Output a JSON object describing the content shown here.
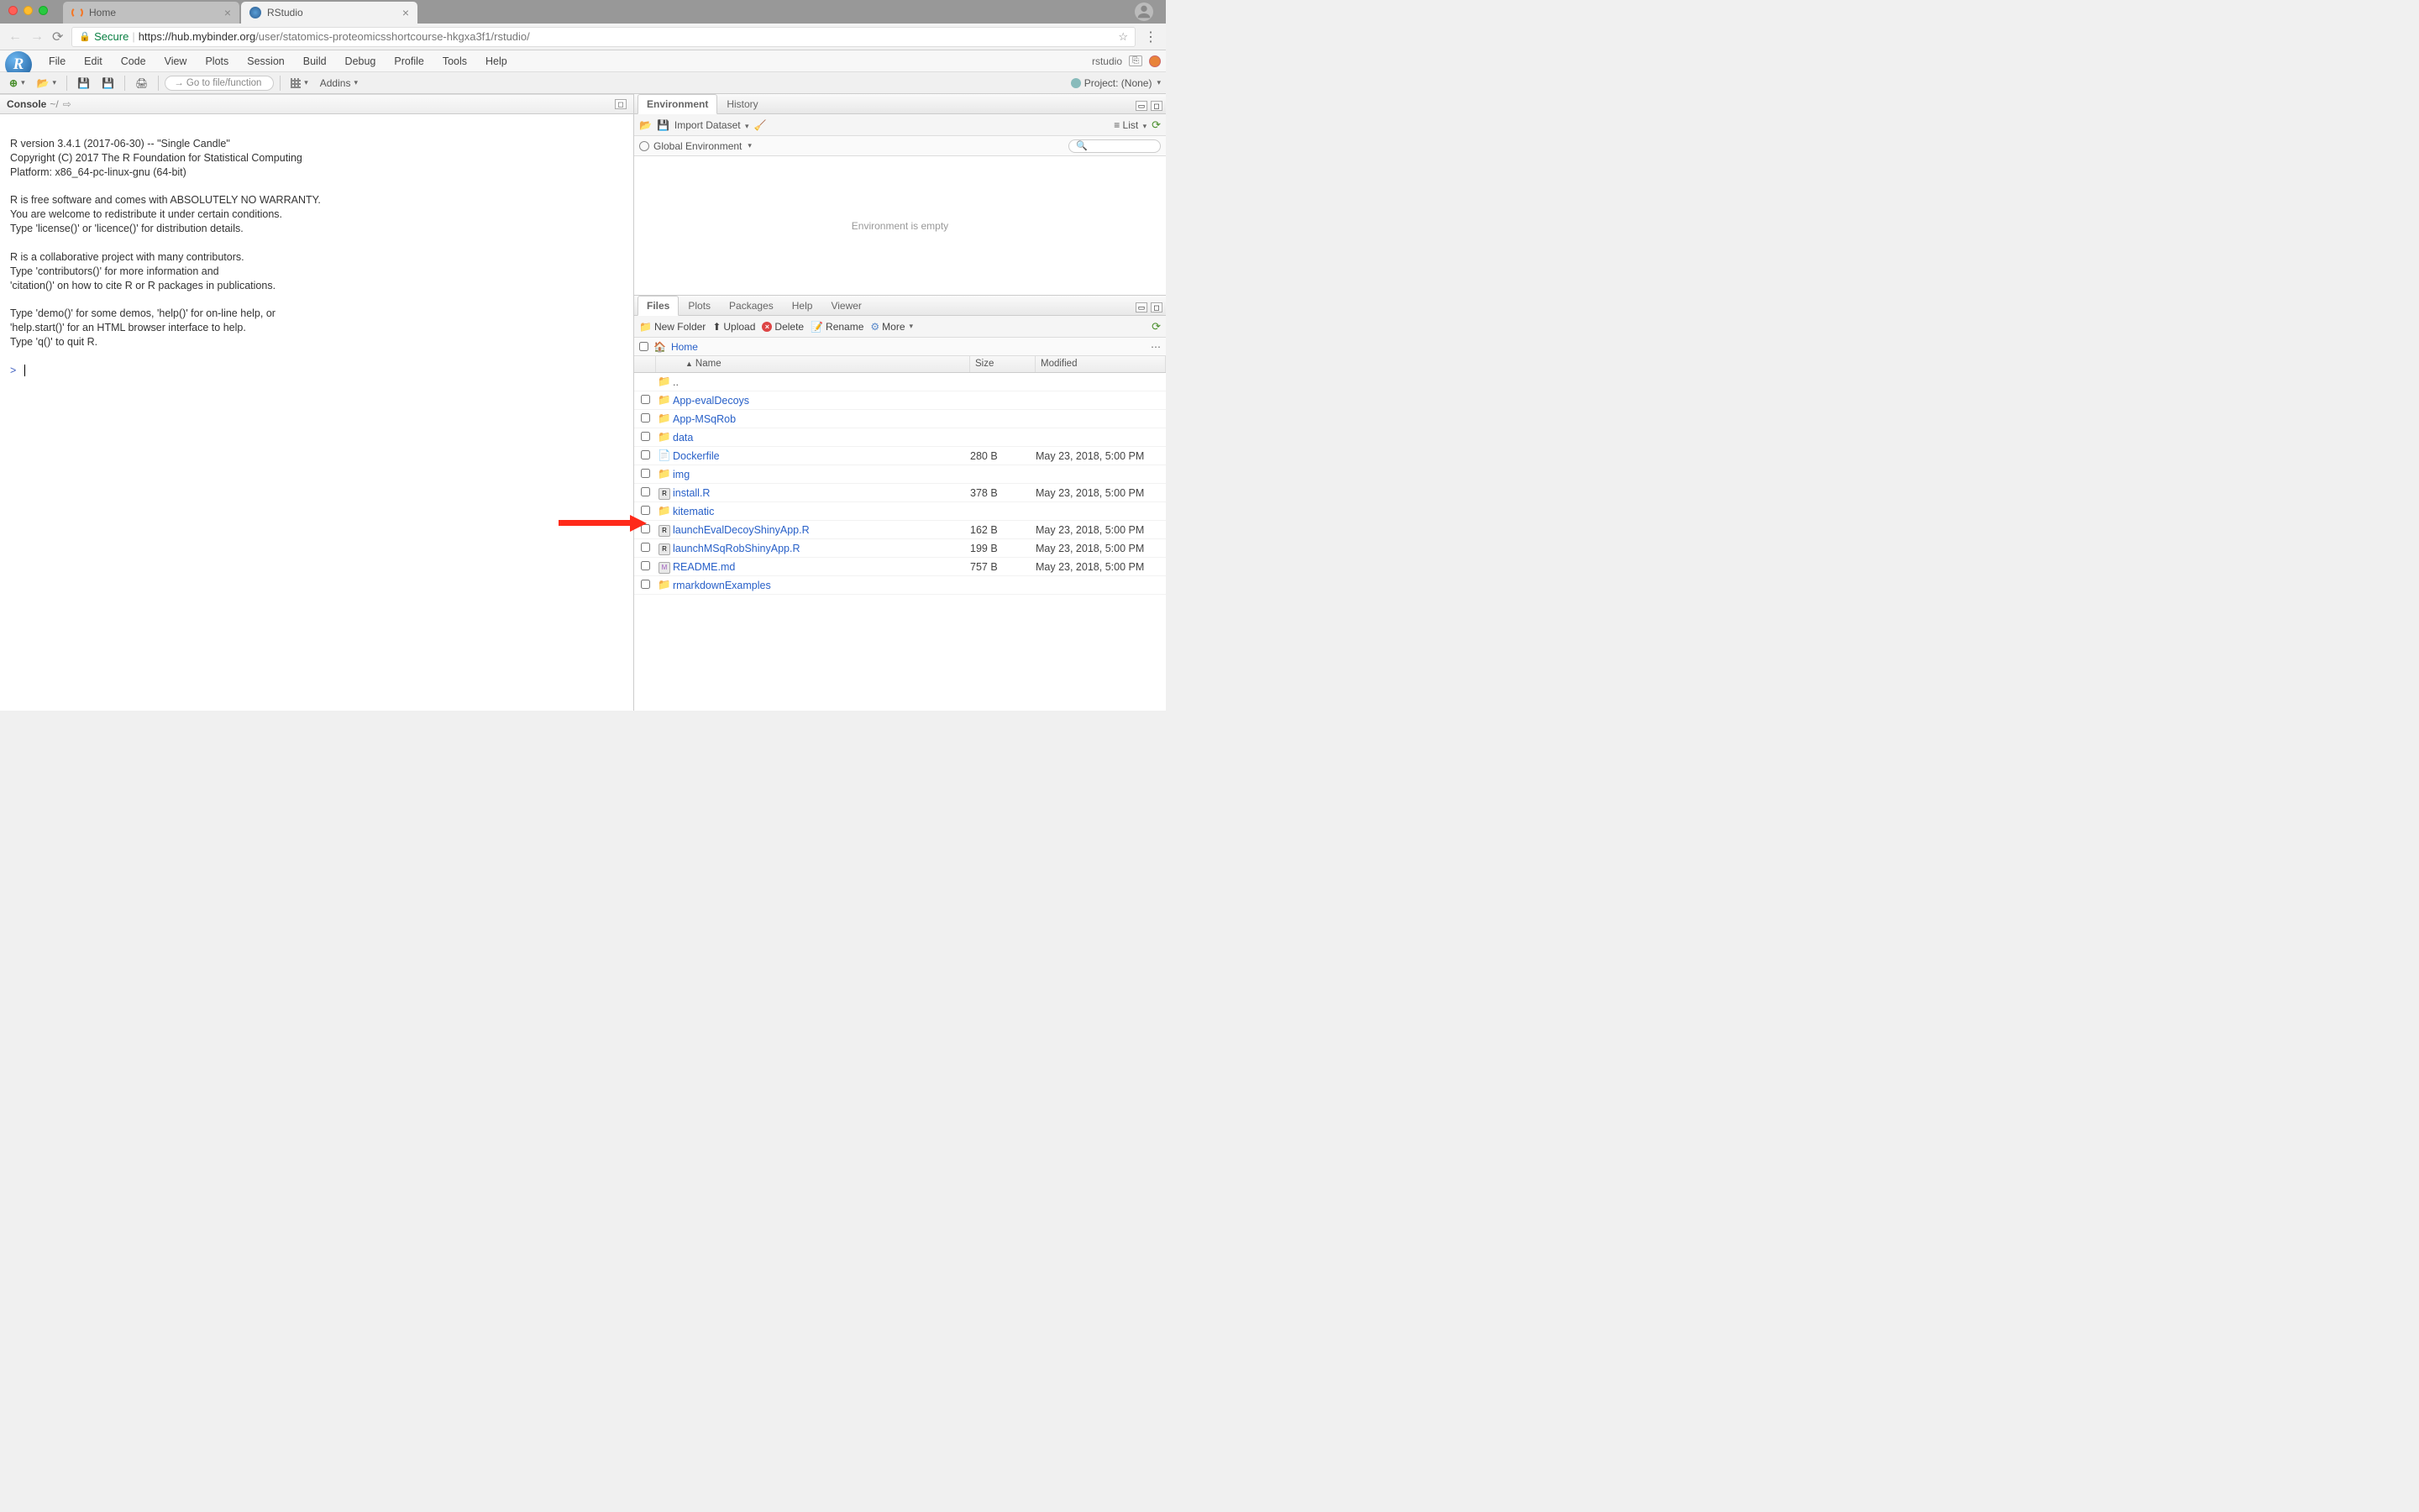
{
  "browser": {
    "tabs": [
      {
        "label": "Home",
        "active": false
      },
      {
        "label": "RStudio",
        "active": true
      }
    ],
    "secure_label": "Secure",
    "url_proto": "https://",
    "url_domain": "hub.mybinder.org",
    "url_path": "/user/statomics-proteomicsshortcourse-hkgxa3f1/rstudio/"
  },
  "menubar": {
    "items": [
      "File",
      "Edit",
      "Code",
      "View",
      "Plots",
      "Session",
      "Build",
      "Debug",
      "Profile",
      "Tools",
      "Help"
    ],
    "user": "rstudio"
  },
  "toolbar": {
    "goto_placeholder": "Go to file/function",
    "addins": "Addins",
    "project_label": "Project: (None)"
  },
  "console": {
    "title": "Console",
    "path": "~/",
    "body": "\nR version 3.4.1 (2017-06-30) -- \"Single Candle\"\nCopyright (C) 2017 The R Foundation for Statistical Computing\nPlatform: x86_64-pc-linux-gnu (64-bit)\n\nR is free software and comes with ABSOLUTELY NO WARRANTY.\nYou are welcome to redistribute it under certain conditions.\nType 'license()' or 'licence()' for distribution details.\n\nR is a collaborative project with many contributors.\nType 'contributors()' for more information and\n'citation()' on how to cite R or R packages in publications.\n\nType 'demo()' for some demos, 'help()' for on-line help, or\n'help.start()' for an HTML browser interface to help.\nType 'q()' to quit R.\n",
    "prompt": ">"
  },
  "env_pane": {
    "tabs": [
      "Environment",
      "History"
    ],
    "import": "Import Dataset",
    "list": "List",
    "scope": "Global Environment",
    "empty": "Environment is empty"
  },
  "files_pane": {
    "tabs": [
      "Files",
      "Plots",
      "Packages",
      "Help",
      "Viewer"
    ],
    "toolbar": {
      "new": "New Folder",
      "upload": "Upload",
      "delete": "Delete",
      "rename": "Rename",
      "more": "More"
    },
    "breadcrumb": "Home",
    "columns": {
      "name": "Name",
      "size": "Size",
      "modified": "Modified"
    },
    "files": [
      {
        "name": "..",
        "type": "up",
        "size": "",
        "modified": ""
      },
      {
        "name": "App-evalDecoys",
        "type": "folder",
        "size": "",
        "modified": ""
      },
      {
        "name": "App-MSqRob",
        "type": "folder",
        "size": "",
        "modified": ""
      },
      {
        "name": "data",
        "type": "folder",
        "size": "",
        "modified": ""
      },
      {
        "name": "Dockerfile",
        "type": "file",
        "size": "280 B",
        "modified": "May 23, 2018, 5:00 PM"
      },
      {
        "name": "img",
        "type": "folder",
        "size": "",
        "modified": ""
      },
      {
        "name": "install.R",
        "type": "rfile",
        "size": "378 B",
        "modified": "May 23, 2018, 5:00 PM"
      },
      {
        "name": "kitematic",
        "type": "folder",
        "size": "",
        "modified": ""
      },
      {
        "name": "launchEvalDecoyShinyApp.R",
        "type": "rfile",
        "size": "162 B",
        "modified": "May 23, 2018, 5:00 PM"
      },
      {
        "name": "launchMSqRobShinyApp.R",
        "type": "rfile",
        "size": "199 B",
        "modified": "May 23, 2018, 5:00 PM"
      },
      {
        "name": "README.md",
        "type": "mdfile",
        "size": "757 B",
        "modified": "May 23, 2018, 5:00 PM"
      },
      {
        "name": "rmarkdownExamples",
        "type": "folder",
        "size": "",
        "modified": ""
      }
    ]
  }
}
